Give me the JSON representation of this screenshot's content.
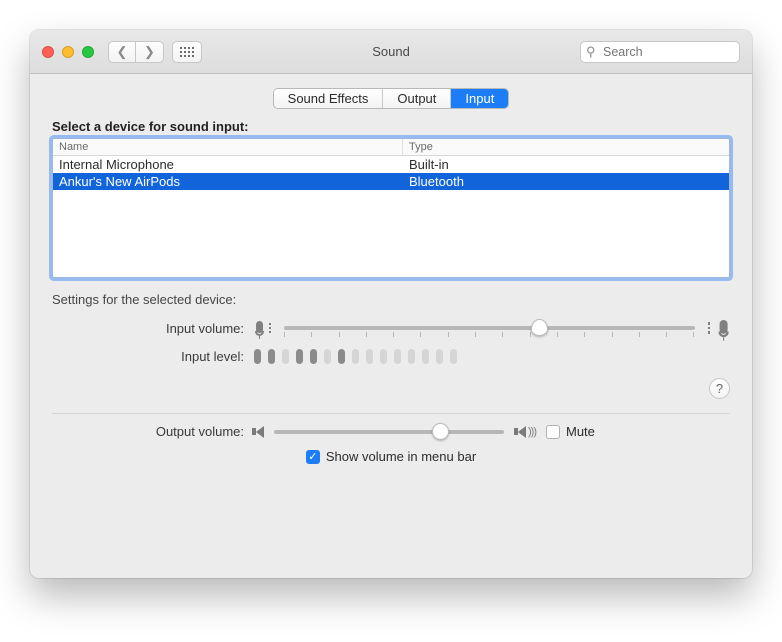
{
  "window": {
    "title": "Sound"
  },
  "search": {
    "placeholder": "Search"
  },
  "tabs": {
    "sound_effects": "Sound Effects",
    "output": "Output",
    "input": "Input"
  },
  "input": {
    "section_label": "Select a device for sound input:",
    "columns": {
      "name": "Name",
      "type": "Type"
    },
    "devices": [
      {
        "name": "Internal Microphone",
        "type": "Built-in"
      },
      {
        "name": "Ankur's New AirPods",
        "type": "Bluetooth"
      }
    ],
    "settings_label": "Settings for the selected device:",
    "input_volume_label": "Input volume:",
    "input_level_label": "Input level:"
  },
  "output": {
    "label": "Output volume:",
    "mute_label": "Mute",
    "show_menu_label": "Show volume in menu bar"
  },
  "help": {
    "symbol": "?"
  }
}
